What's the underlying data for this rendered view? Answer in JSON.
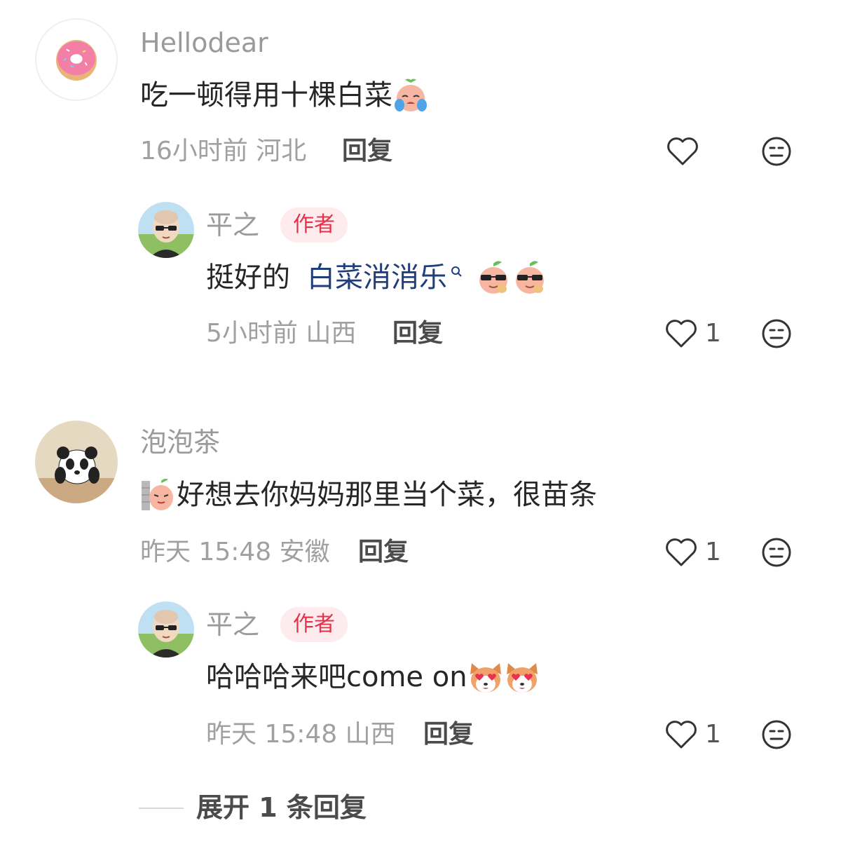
{
  "comments": [
    {
      "username": "Hellodear",
      "avatar": "donut-avatar",
      "text": "吃一顿得用十棵白菜",
      "emoji": "crying-cabbage-emoji",
      "time": "16小时前",
      "location": "河北",
      "reply_label": "回复",
      "likes": "",
      "replies": [
        {
          "username": "平之",
          "badge": "作者",
          "avatar": "bald-man-avatar",
          "text": "挺好的",
          "topic": "白菜消消乐",
          "emoji": "cool-cabbage-emoji",
          "time": "5小时前",
          "location": "山西",
          "reply_label": "回复",
          "likes": "1"
        }
      ]
    },
    {
      "username": "泡泡茶",
      "avatar": "panda-avatar",
      "text": "好想去你妈妈那里当个菜，很苗条",
      "emoji": "peeking-cabbage-emoji",
      "time": "昨天 15:48",
      "location": "安徽",
      "reply_label": "回复",
      "likes": "1",
      "replies": [
        {
          "username": "平之",
          "badge": "作者",
          "avatar": "bald-man-avatar",
          "text": "哈哈哈来吧come on",
          "emoji": "heart-eyes-dog-emoji",
          "time": "昨天 15:48",
          "location": "山西",
          "reply_label": "回复",
          "likes": "1"
        }
      ],
      "expand_label": "展开 1 条回复"
    }
  ],
  "colors": {
    "badge_bg": "#fdebed",
    "badge_text": "#e5314a",
    "topic_link": "#1f3e7a",
    "meta_text": "#a0a0a0"
  }
}
